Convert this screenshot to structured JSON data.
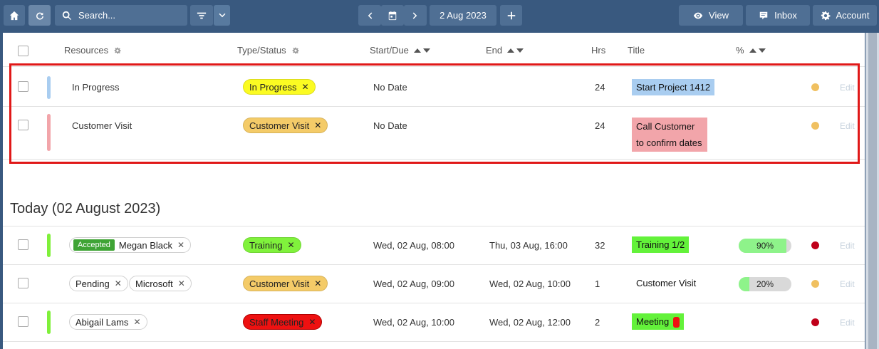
{
  "toolbar": {
    "search_placeholder": "Search...",
    "date_label": "2 Aug 2023",
    "view_label": "View",
    "inbox_label": "Inbox",
    "account_label": "Account"
  },
  "header": {
    "resources": "Resources",
    "type_status": "Type/Status",
    "start_due": "Start/Due",
    "end": "End",
    "hrs": "Hrs",
    "title": "Title",
    "percent": "%"
  },
  "undated": [
    {
      "bar_color": "#a9cdf0",
      "resource": "In Progress",
      "type": "In Progress",
      "type_color": "#fbfb22",
      "start": "No Date",
      "hrs": "24",
      "title": "Start Project 1412",
      "title_color": "#a9cdf0",
      "dot_color": "#f0c060",
      "edit": "Edit"
    },
    {
      "bar_color": "#f2a5aa",
      "resource": "Customer Visit",
      "type": "Customer Visit",
      "type_color": "#f4cb68",
      "start": "No Date",
      "hrs": "24",
      "title": "Call Customer to confirm dates",
      "title_color": "#f2a5aa",
      "dot_color": "#f0c060",
      "edit": "Edit"
    }
  ],
  "today": {
    "heading": "Today (02 August 2023)",
    "rows": [
      {
        "bar_color": "#7ff03a",
        "badge": "Accepted",
        "resources": [
          "Megan Black"
        ],
        "type": "Training",
        "type_color": "#80f23c",
        "start": "Wed, 02 Aug, 08:00",
        "end": "Thu, 03 Aug, 16:00",
        "hrs": "32",
        "title": "Training 1/2",
        "title_color": "#63f23a",
        "progress": 90,
        "progress_label": "90%",
        "dot_color": "#c0001a",
        "edit": "Edit"
      },
      {
        "bar_color": "",
        "badge": "",
        "resources": [
          "Pending",
          "Microsoft"
        ],
        "type": "Customer Visit",
        "type_color": "#f4cb68",
        "start": "Wed, 02 Aug, 09:00",
        "end": "Wed, 02 Aug, 10:00",
        "hrs": "1",
        "title": "Customer Visit",
        "title_color": "",
        "progress": 20,
        "progress_label": "20%",
        "dot_color": "#f0c060",
        "edit": "Edit"
      },
      {
        "bar_color": "#7ff03a",
        "badge": "",
        "resources": [
          "Abigail Lams"
        ],
        "type": "Staff Meeting",
        "type_color": "#ee1111",
        "start": "Wed, 02 Aug, 10:00",
        "end": "Wed, 02 Aug, 12:00",
        "hrs": "2",
        "title": "Meeting",
        "title_color": "#63f23a",
        "progress": null,
        "progress_label": "",
        "dot_color": "#c0001a",
        "edit": "Edit"
      }
    ]
  },
  "icons": [
    "home-icon",
    "refresh-icon",
    "search-icon",
    "filter-icon",
    "chevron-down-icon",
    "chevron-left-icon",
    "calendar-icon",
    "chevron-right-icon",
    "plus-icon",
    "eye-icon",
    "inbox-icon",
    "gear-icon"
  ]
}
